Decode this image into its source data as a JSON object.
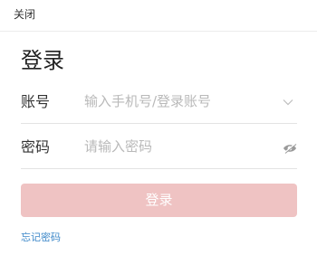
{
  "header": {
    "close_label": "关闭"
  },
  "login": {
    "title": "登录",
    "account_label": "账号",
    "account_value": "",
    "account_placeholder": "输入手机号/登录账号",
    "password_label": "密码",
    "password_value": "",
    "password_placeholder": "请输入密码",
    "submit_label": "登录",
    "forgot_label": "忘记密码"
  },
  "icons": {
    "account_dropdown": "chevron-down-icon",
    "password_visibility": "eye-icon"
  },
  "colors": {
    "submit_bg": "#efc3c3",
    "link": "#3d88c9",
    "placeholder": "#b9b9b9"
  }
}
